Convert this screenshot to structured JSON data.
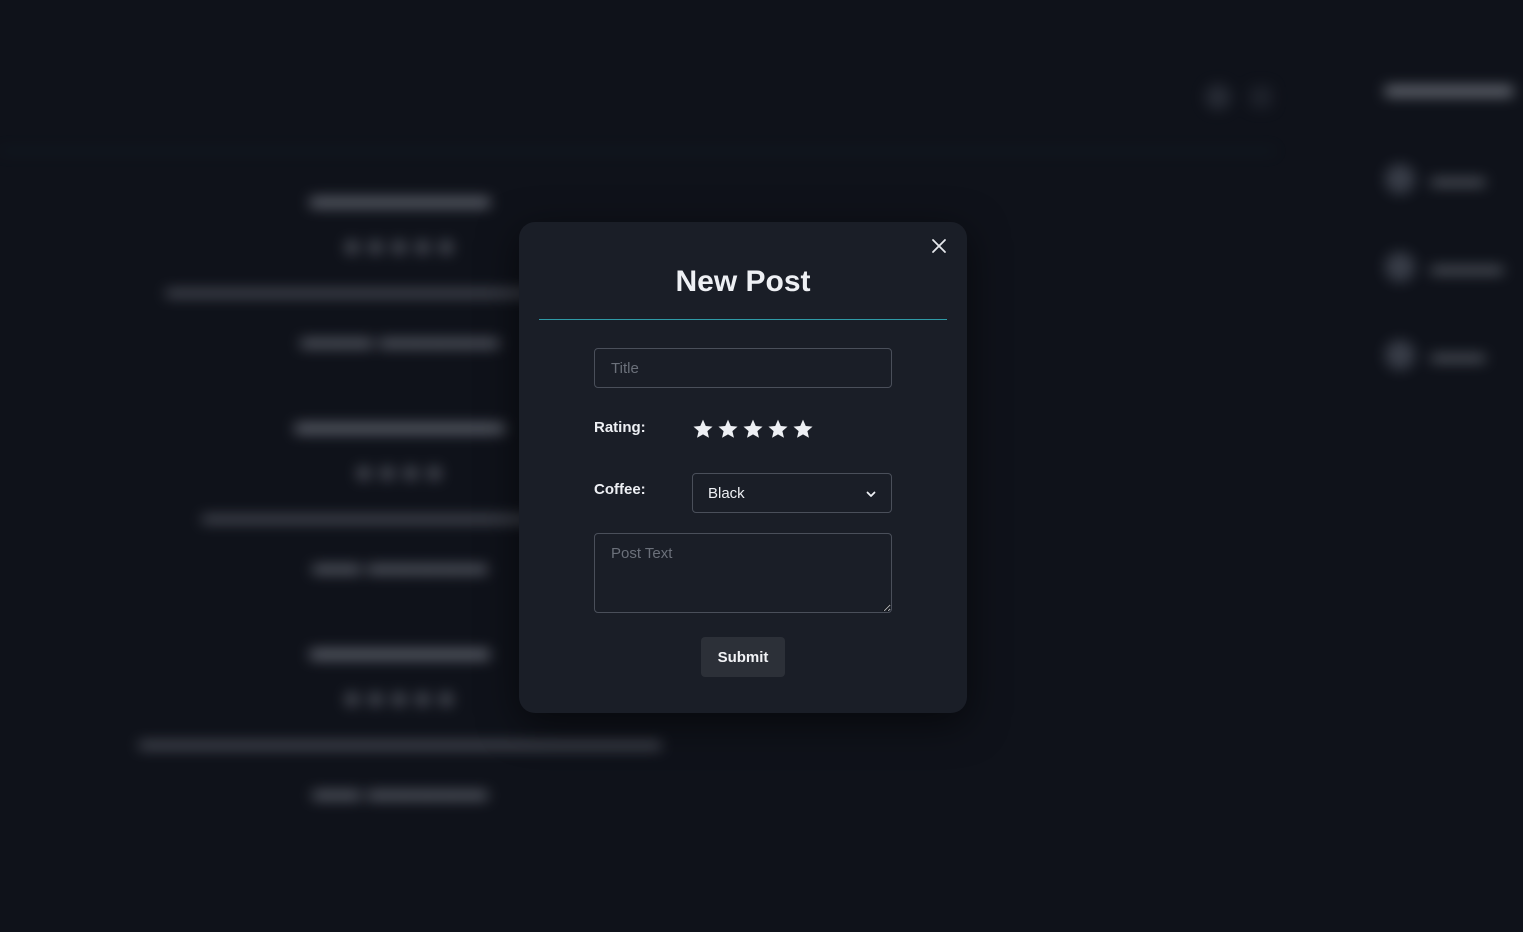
{
  "modal": {
    "title": "New Post",
    "close_icon": "close-icon",
    "title_placeholder": "Title",
    "rating_label": "Rating:",
    "rating_max": 5,
    "star_icon": "star-icon",
    "coffee_label": "Coffee:",
    "coffee_selected": "Black",
    "coffee_chevron_icon": "chevron-down-icon",
    "post_text_placeholder": "Post Text",
    "submit_label": "Submit"
  },
  "colors": {
    "background": "#0f121a",
    "modal_bg": "#1a1e27",
    "divider_accent": "#2f9aa6",
    "button_bg": "#2c3038",
    "text": "#eef0f4"
  }
}
